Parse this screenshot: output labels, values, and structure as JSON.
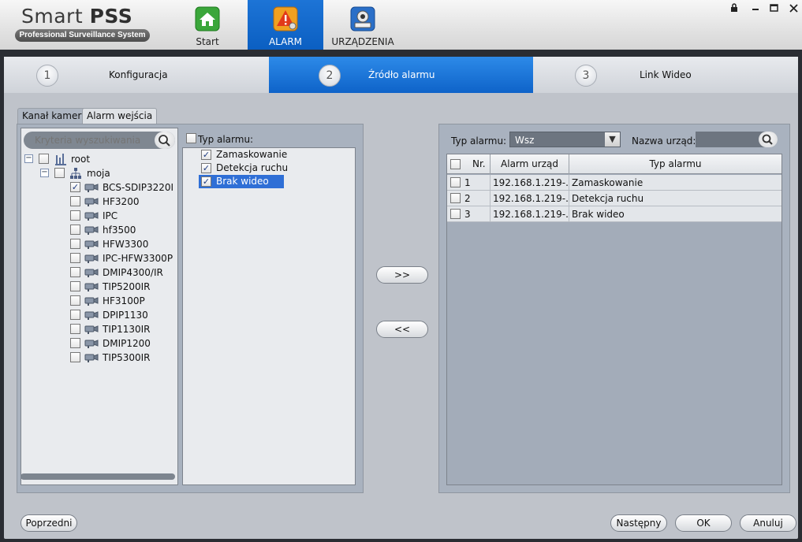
{
  "app": {
    "title": "Smart",
    "title_bold": "PSS",
    "subtitle": "Professional Surveillance System"
  },
  "nav": [
    {
      "label": "Start",
      "icon": "home-icon"
    },
    {
      "label": "ALARM",
      "icon": "alarm-icon"
    },
    {
      "label": "URZĄDZENIA",
      "icon": "devices-icon"
    }
  ],
  "window_controls": [
    "lock-icon",
    "minimize-icon",
    "maximize-icon",
    "close-icon"
  ],
  "steps": [
    {
      "num": "1",
      "label": "Konfiguracja"
    },
    {
      "num": "2",
      "label": "Źródło alarmu"
    },
    {
      "num": "3",
      "label": "Link Wideo"
    }
  ],
  "tabs": {
    "camera": "Kanał kamery",
    "input": "Alarm wejścia"
  },
  "search": {
    "placeholder": "Kryteria wyszukiwania"
  },
  "tree": {
    "root": "root",
    "group": "moja",
    "devices": [
      {
        "name": "BCS-SDIP3220I",
        "checked": true
      },
      {
        "name": "HF3200",
        "checked": false
      },
      {
        "name": "IPC",
        "checked": false
      },
      {
        "name": "hf3500",
        "checked": false
      },
      {
        "name": "HFW3300",
        "checked": false
      },
      {
        "name": "IPC-HFW3300P",
        "checked": false
      },
      {
        "name": "DMIP4300/IR",
        "checked": false
      },
      {
        "name": "TIP5200IR",
        "checked": false
      },
      {
        "name": "HF3100P",
        "checked": false
      },
      {
        "name": "DPIP1130",
        "checked": false
      },
      {
        "name": "TIP1130IR",
        "checked": false
      },
      {
        "name": "DMIP1200",
        "checked": false
      },
      {
        "name": "TIP5300IR",
        "checked": false
      }
    ]
  },
  "alarm_types": {
    "header": "Typ alarmu:",
    "items": [
      {
        "label": "Zamaskowanie",
        "checked": true
      },
      {
        "label": "Detekcja ruchu",
        "checked": true
      },
      {
        "label": "Brak wideo",
        "checked": true
      }
    ]
  },
  "transfer": {
    "add": ">>",
    "remove": "<<"
  },
  "filter": {
    "type_label": "Typ alarmu:",
    "type_value": "Wsz",
    "device_label": "Nazwa urząd:"
  },
  "table": {
    "columns": [
      "Nr.",
      "Alarm urząd",
      "Typ alarmu"
    ],
    "rows": [
      {
        "nr": "1",
        "device": "192.168.1.219-...",
        "type": "Zamaskowanie"
      },
      {
        "nr": "2",
        "device": "192.168.1.219-...",
        "type": "Detekcja ruchu"
      },
      {
        "nr": "3",
        "device": "192.168.1.219-...",
        "type": "Brak wideo"
      }
    ]
  },
  "buttons": {
    "prev": "Poprzedni",
    "next": "Następny",
    "ok": "OK",
    "cancel": "Anuluj"
  },
  "colors": {
    "accent": "#1d74d6",
    "panel": "#bfc3ca",
    "highlight": "#2f6fd6"
  }
}
